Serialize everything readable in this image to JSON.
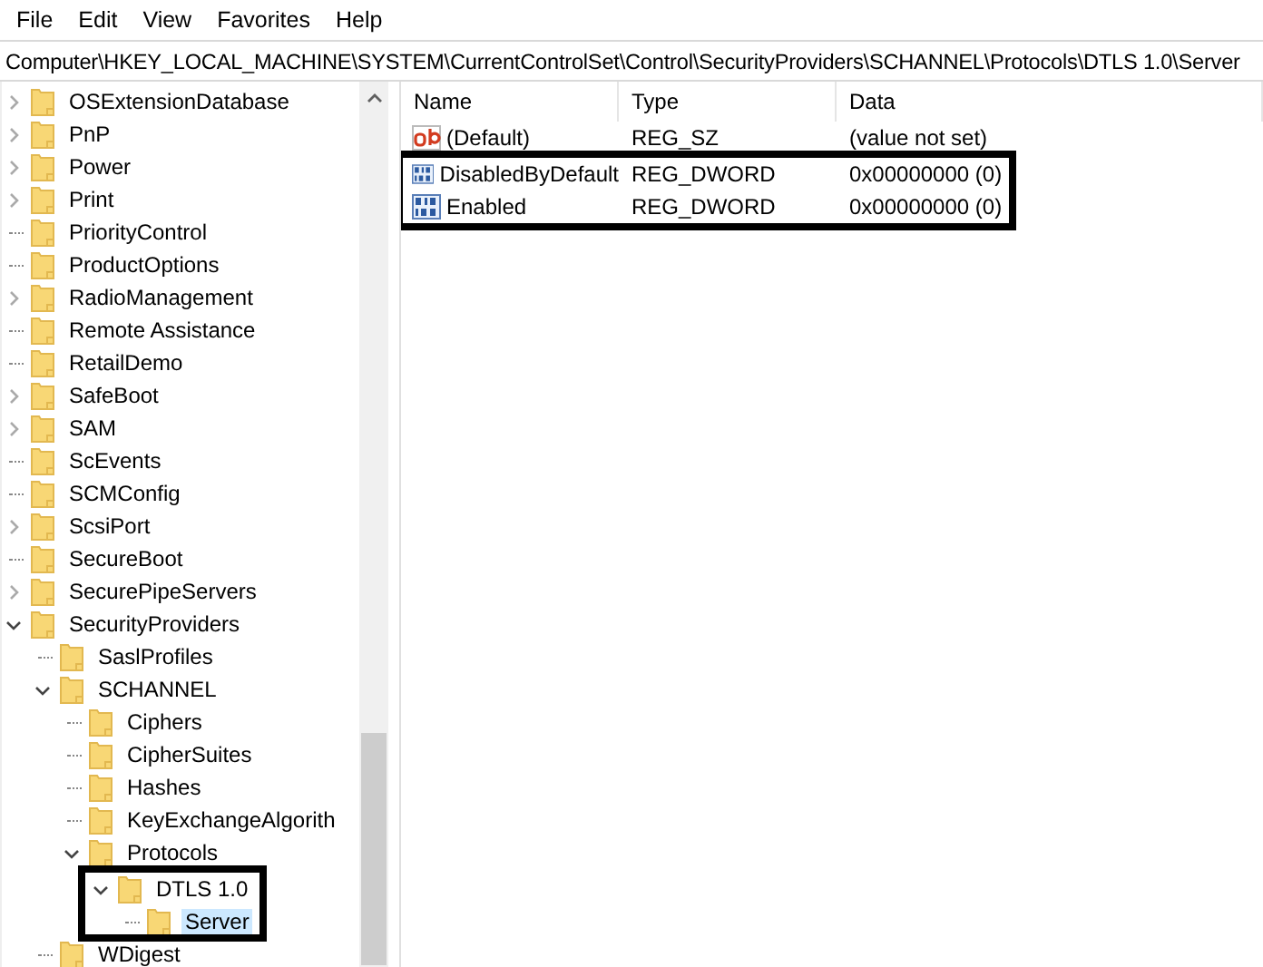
{
  "menu": [
    "File",
    "Edit",
    "View",
    "Favorites",
    "Help"
  ],
  "address": "Computer\\HKEY_LOCAL_MACHINE\\SYSTEM\\CurrentControlSet\\Control\\SecurityProviders\\SCHANNEL\\Protocols\\DTLS 1.0\\Server",
  "tree": [
    {
      "label": "OSExtensionDatabase",
      "kind": "branch",
      "expanded": false
    },
    {
      "label": "PnP",
      "kind": "branch",
      "expanded": false
    },
    {
      "label": "Power",
      "kind": "branch",
      "expanded": false
    },
    {
      "label": "Print",
      "kind": "branch",
      "expanded": false
    },
    {
      "label": "PriorityControl",
      "kind": "leaf"
    },
    {
      "label": "ProductOptions",
      "kind": "leaf"
    },
    {
      "label": "RadioManagement",
      "kind": "branch",
      "expanded": false
    },
    {
      "label": "Remote Assistance",
      "kind": "leaf"
    },
    {
      "label": "RetailDemo",
      "kind": "leaf"
    },
    {
      "label": "SafeBoot",
      "kind": "branch",
      "expanded": false
    },
    {
      "label": "SAM",
      "kind": "branch",
      "expanded": false
    },
    {
      "label": "ScEvents",
      "kind": "leaf"
    },
    {
      "label": "SCMConfig",
      "kind": "leaf"
    },
    {
      "label": "ScsiPort",
      "kind": "branch",
      "expanded": false
    },
    {
      "label": "SecureBoot",
      "kind": "leaf"
    },
    {
      "label": "SecurePipeServers",
      "kind": "branch",
      "expanded": false
    },
    {
      "label": "SecurityProviders",
      "kind": "branch",
      "expanded": true,
      "children": [
        {
          "label": "SaslProfiles",
          "kind": "leaf"
        },
        {
          "label": "SCHANNEL",
          "kind": "branch",
          "expanded": true,
          "children": [
            {
              "label": "Ciphers",
              "kind": "leaf"
            },
            {
              "label": "CipherSuites",
              "kind": "leaf"
            },
            {
              "label": "Hashes",
              "kind": "leaf"
            },
            {
              "label": "KeyExchangeAlgorith",
              "kind": "leaf"
            },
            {
              "label": "Protocols",
              "kind": "branch",
              "expanded": true,
              "children": [
                {
                  "label": "DTLS 1.0",
                  "kind": "branch",
                  "expanded": true,
                  "highlighted": true,
                  "children": [
                    {
                      "label": "Server",
                      "kind": "leaf",
                      "selected": true
                    }
                  ]
                }
              ]
            }
          ]
        },
        {
          "label": "WDigest",
          "kind": "leaf"
        }
      ]
    }
  ],
  "columns": [
    "Name",
    "Type",
    "Data"
  ],
  "values": [
    {
      "name": "(Default)",
      "type": "REG_SZ",
      "data": "(value not set)",
      "kind": "string",
      "highlighted": false
    },
    {
      "name": "DisabledByDefault",
      "type": "REG_DWORD",
      "data": "0x00000000 (0)",
      "kind": "binary",
      "highlighted": true
    },
    {
      "name": "Enabled",
      "type": "REG_DWORD",
      "data": "0x00000000 (0)",
      "kind": "binary",
      "highlighted": true
    }
  ]
}
